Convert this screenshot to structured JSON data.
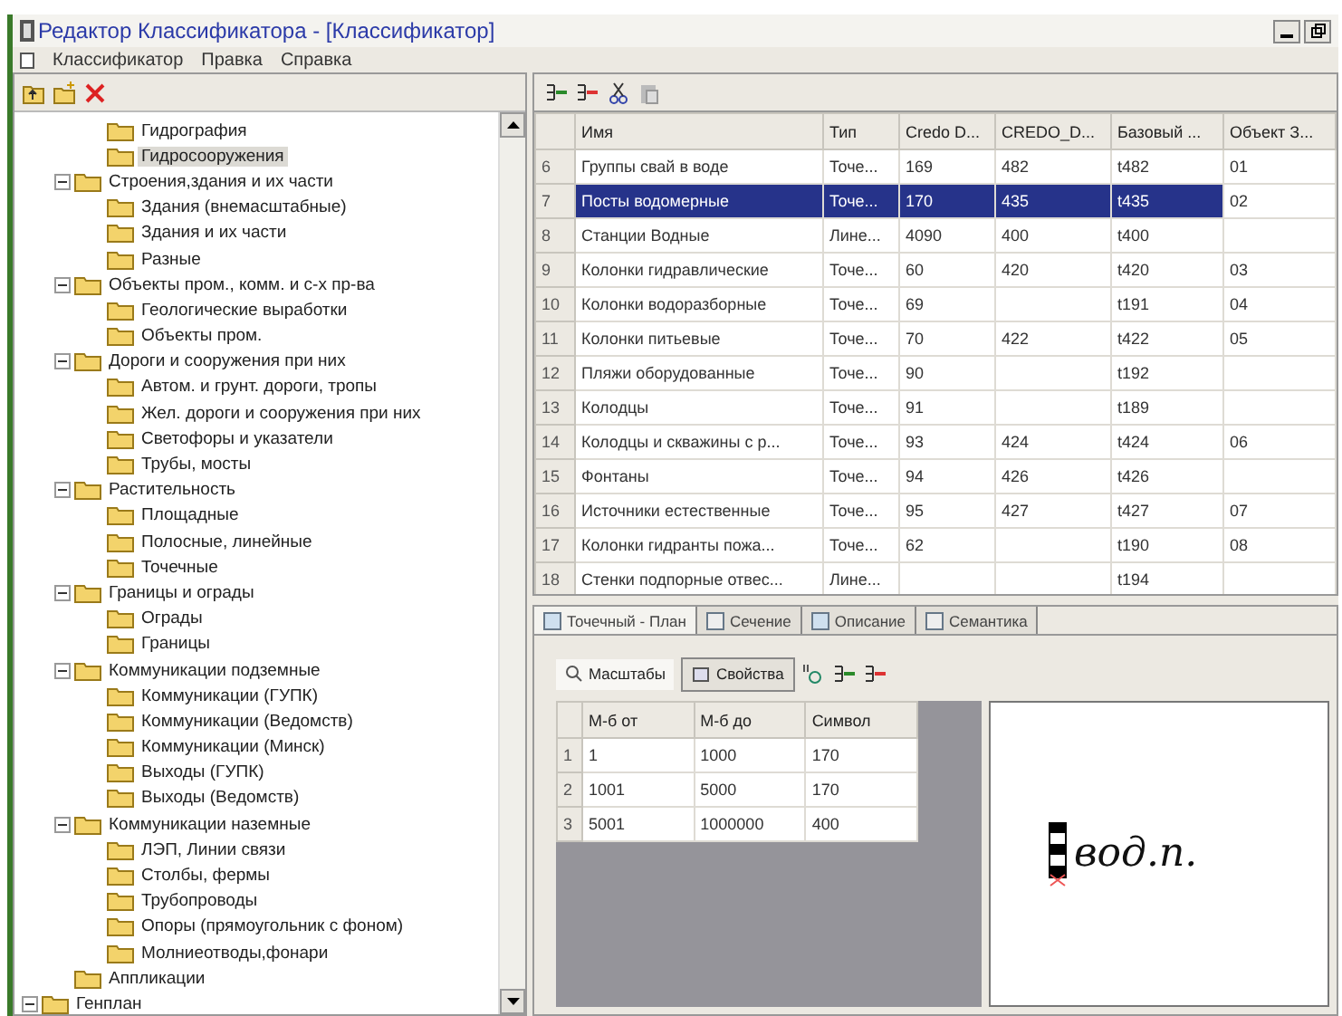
{
  "window": {
    "title": "Редактор Классификатора - [Классификатор]"
  },
  "menu": [
    "Классификатор",
    "Правка",
    "Справка"
  ],
  "tree": [
    {
      "children": [
        {
          "children": [
            {
              "label": "Гидрография",
              "selected": false
            },
            {
              "label": "Гидросооружения",
              "selected": true
            }
          ]
        },
        {
          "label": "Строения,здания и их части",
          "expanded": true,
          "selected": false,
          "children": [
            {
              "label": "Здания (внемасштабные)",
              "selected": false
            },
            {
              "label": "Здания и их части",
              "selected": false
            },
            {
              "label": "Разные",
              "selected": false
            }
          ]
        },
        {
          "label": "Объекты пром., комм. и с-х пр-ва",
          "expanded": true,
          "selected": false,
          "children": [
            {
              "label": "Геологические выработки",
              "selected": false
            },
            {
              "label": "Объекты пром.",
              "selected": false
            }
          ]
        },
        {
          "label": "Дороги и сооружения при них",
          "expanded": true,
          "selected": false,
          "children": [
            {
              "label": "Автом. и грунт. дороги, тропы",
              "selected": false
            },
            {
              "label": "Жел. дороги и сооружения при них",
              "selected": false
            },
            {
              "label": "Светофоры и указатели",
              "selected": false
            },
            {
              "label": "Трубы, мосты",
              "selected": false
            }
          ]
        },
        {
          "label": "Растительность",
          "expanded": true,
          "selected": false,
          "children": [
            {
              "label": "Площадные",
              "selected": false
            },
            {
              "label": "Полосные, линейные",
              "selected": false
            },
            {
              "label": "Точечные",
              "selected": false
            }
          ]
        },
        {
          "label": "Границы и ограды",
          "expanded": true,
          "selected": false,
          "children": [
            {
              "label": "Ограды",
              "selected": false
            },
            {
              "label": "Границы",
              "selected": false
            }
          ]
        },
        {
          "label": "Коммуникации подземные",
          "expanded": true,
          "selected": false,
          "children": [
            {
              "label": "Коммуникации (ГУПК)",
              "selected": false
            },
            {
              "label": "Коммуникации (Ведомств)",
              "selected": false
            },
            {
              "label": "Коммуникации (Минск)",
              "selected": false
            },
            {
              "label": "Выходы (ГУПК)",
              "selected": false
            },
            {
              "label": "Выходы (Ведомств)",
              "selected": false
            }
          ]
        },
        {
          "label": "Коммуникации наземные",
          "expanded": true,
          "selected": false,
          "children": [
            {
              "label": "ЛЭП, Линии связи",
              "selected": false
            },
            {
              "label": "Столбы, фермы",
              "selected": false
            },
            {
              "label": "Трубопроводы",
              "selected": false
            },
            {
              "label": "Опоры (прямоугольник с фоном)",
              "selected": false
            },
            {
              "label": "Молниеотводы,фонари",
              "selected": false
            }
          ]
        },
        {
          "label": "Аппликации",
          "selected": false
        }
      ]
    },
    {
      "label": "Генплан",
      "expanded": true,
      "selected": false
    }
  ],
  "table": {
    "columns": [
      "Имя",
      "Тип",
      "Credo D...",
      "CREDO_D...",
      "Базовый ...",
      "Объект З..."
    ],
    "rows": [
      {
        "num": "6",
        "cells": [
          "Группы свай в воде",
          "Точе...",
          "169",
          "482",
          "t482",
          "01"
        ],
        "selected": false
      },
      {
        "num": "7",
        "cells": [
          "Посты водомерные",
          "Точе...",
          "170",
          "435",
          "t435",
          "02"
        ],
        "selected": true
      },
      {
        "num": "8",
        "cells": [
          "Станции  Водные",
          "Лине...",
          "4090",
          "400",
          "t400",
          ""
        ],
        "selected": false
      },
      {
        "num": "9",
        "cells": [
          "Колонки гидравлические",
          "Точе...",
          "60",
          "420",
          "t420",
          "03"
        ],
        "selected": false
      },
      {
        "num": "10",
        "cells": [
          "Колонки водоразборные",
          "Точе...",
          "69",
          "",
          "t191",
          "04"
        ],
        "selected": false
      },
      {
        "num": "11",
        "cells": [
          "Колонки питьевые",
          "Точе...",
          "70",
          "422",
          "t422",
          "05"
        ],
        "selected": false
      },
      {
        "num": "12",
        "cells": [
          "Пляжи оборудованные",
          "Точе...",
          "90",
          "",
          "t192",
          ""
        ],
        "selected": false
      },
      {
        "num": "13",
        "cells": [
          "Колодцы",
          "Точе...",
          "91",
          "",
          "t189",
          ""
        ],
        "selected": false
      },
      {
        "num": "14",
        "cells": [
          "Колодцы и скважины с р...",
          "Точе...",
          "93",
          "424",
          "t424",
          "06"
        ],
        "selected": false
      },
      {
        "num": "15",
        "cells": [
          "Фонтаны",
          "Точе...",
          "94",
          "426",
          "t426",
          ""
        ],
        "selected": false
      },
      {
        "num": "16",
        "cells": [
          "Источники естественные",
          "Точе...",
          "95",
          "427",
          "t427",
          "07"
        ],
        "selected": false
      },
      {
        "num": "17",
        "cells": [
          "Колонки  гидранты пожа...",
          "Точе...",
          "62",
          "",
          "t190",
          "08"
        ],
        "selected": false
      },
      {
        "num": "18",
        "cells": [
          "Стенки подпорные отвес...",
          "Лине...",
          "",
          "",
          "t194",
          ""
        ],
        "selected": false
      }
    ]
  },
  "tabs": [
    {
      "label": "Точечный - План",
      "selected": true
    },
    {
      "label": "Сечение",
      "selected": false
    },
    {
      "label": "Описание",
      "selected": false
    },
    {
      "label": "Семантика",
      "selected": false
    }
  ],
  "subtabs": [
    {
      "label": "Масштабы",
      "selected": true
    },
    {
      "label": "Свойства",
      "selected": false
    }
  ],
  "scales": {
    "columns": [
      "М-б от",
      "М-б до",
      "Символ"
    ],
    "rows": [
      {
        "num": "1",
        "cells": [
          "1",
          "1000",
          "170"
        ]
      },
      {
        "num": "2",
        "cells": [
          "1001",
          "5000",
          "170"
        ]
      },
      {
        "num": "3",
        "cells": [
          "5001",
          "1000000",
          "400"
        ]
      }
    ]
  },
  "preview": {
    "caption": "вод.п."
  }
}
